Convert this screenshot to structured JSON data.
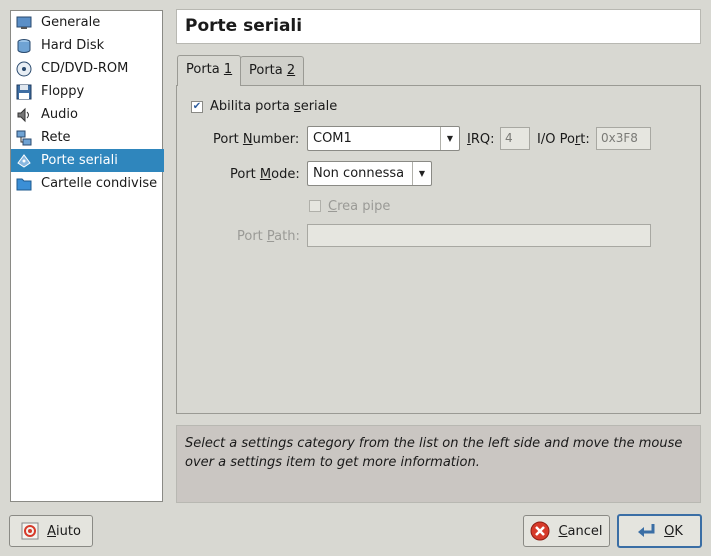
{
  "sidebar": {
    "items": [
      {
        "label": "Generale",
        "icon": "monitor-icon"
      },
      {
        "label": "Hard Disk",
        "icon": "hard-disk-icon"
      },
      {
        "label": "CD/DVD-ROM",
        "icon": "cd-icon"
      },
      {
        "label": "Floppy",
        "icon": "floppy-icon"
      },
      {
        "label": "Audio",
        "icon": "audio-icon"
      },
      {
        "label": "Rete",
        "icon": "network-icon"
      },
      {
        "label": "Porte seriali",
        "icon": "serial-port-icon"
      },
      {
        "label": "Cartelle condivise",
        "icon": "folder-icon"
      }
    ],
    "selected_index": 6
  },
  "page_title": "Porte seriali",
  "tabs": [
    {
      "label_pre": "Porta ",
      "label_mn": "1"
    },
    {
      "label_pre": "Porta ",
      "label_mn": "2"
    }
  ],
  "form": {
    "enable_pre": "Abilita porta ",
    "enable_mn": "s",
    "enable_post": "eriale",
    "enable_checked": true,
    "port_number_pre": "Port ",
    "port_number_mn": "N",
    "port_number_post": "umber:",
    "port_number_value": "COM1",
    "irq_pre": "",
    "irq_mn": "I",
    "irq_post": "RQ:",
    "irq_value": "4",
    "io_port_pre": "I/O Po",
    "io_port_mn": "r",
    "io_port_post": "t:",
    "io_port_value": "0x3F8",
    "port_mode_pre": "Port ",
    "port_mode_mn": "M",
    "port_mode_post": "ode:",
    "port_mode_value": "Non connessa",
    "crea_pipe_pre": "",
    "crea_pipe_mn": "C",
    "crea_pipe_post": "rea pipe",
    "crea_pipe_checked": false,
    "port_path_pre": "Port ",
    "port_path_mn": "P",
    "port_path_post": "ath:",
    "port_path_value": ""
  },
  "info_text": "Select a settings category from the list on the left side and move the mouse over a settings item to get more information.",
  "buttons": {
    "help_pre": "",
    "help_mn": "A",
    "help_post": "iuto",
    "cancel_pre": "",
    "cancel_mn": "C",
    "cancel_post": "ancel",
    "ok_pre": "",
    "ok_mn": "O",
    "ok_post": "K"
  },
  "colors": {
    "selection": "#2f86bd",
    "background": "#d8d8d2",
    "cancel_icon": "#d63a2a",
    "ok_icon": "#3a6ea5"
  }
}
